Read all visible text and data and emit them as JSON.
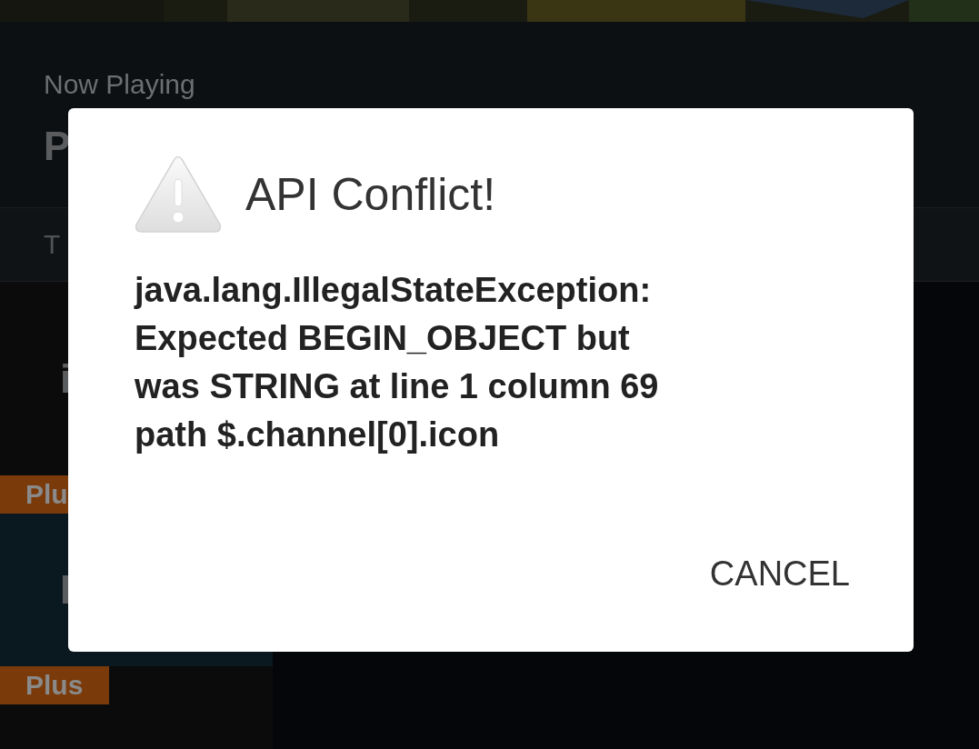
{
  "now_playing": {
    "label": "Now Playing",
    "title": "P"
  },
  "tab_row": {
    "label": "T"
  },
  "list": [
    {
      "kind": "item",
      "text": "i",
      "selected": false
    },
    {
      "kind": "badge",
      "text": "Plu"
    },
    {
      "kind": "item",
      "text": "I",
      "selected": true
    },
    {
      "kind": "badge",
      "text": "Plus"
    }
  ],
  "dialog": {
    "title": "API Conflict!",
    "message": "java.lang.IllegalStateException:\nExpected BEGIN_OBJECT but\nwas STRING at line 1 column 69\npath $.channel[0].icon",
    "buttons": [
      "CANCEL"
    ]
  }
}
